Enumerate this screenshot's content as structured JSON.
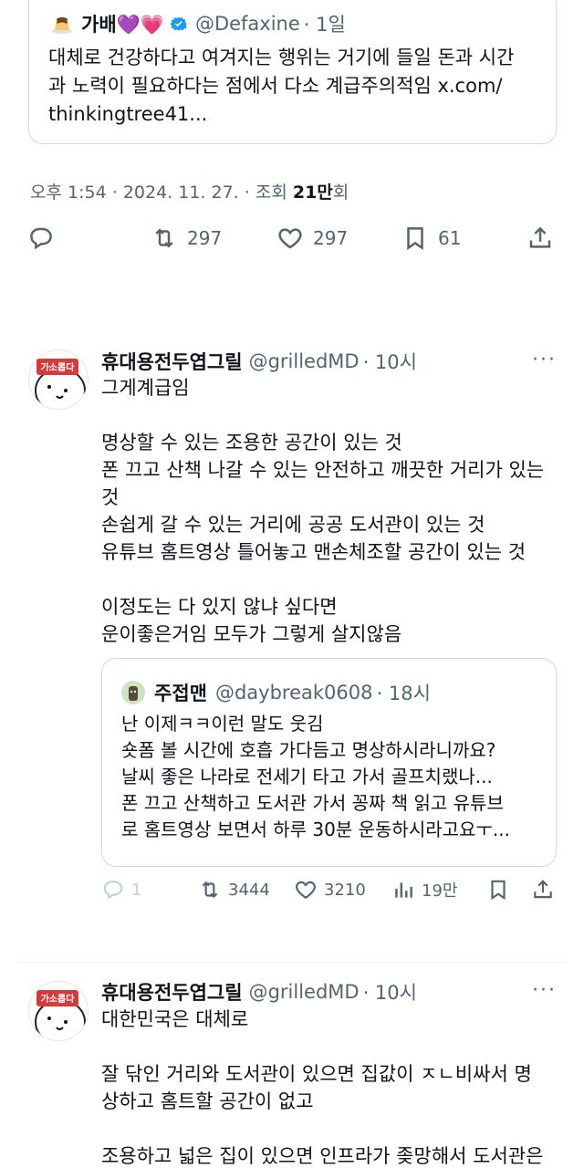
{
  "quoted_top": {
    "display_name": "가배💜💗",
    "handle": "@Defaxine",
    "time": "· 1일",
    "body": "대체로 건강하다고 여겨지는 행위는 거기에 들일 돈과 시간\n과 노력이 필요하다는 점에서 다소 계급주의적임 x.com/\nthinkingtree41..."
  },
  "meta": {
    "time": "오후 1:54",
    "date": "2024. 11. 27.",
    "views_label": "조회",
    "views": "21만",
    "views_suffix": "회"
  },
  "main_actions": {
    "reply_icon": "reply-icon",
    "retweets": "297",
    "likes": "297",
    "bookmarks": "61"
  },
  "reply1": {
    "display_name": "휴대용전두엽그릴",
    "handle": "@grilledMD",
    "time": "· 10시",
    "more": "···",
    "avatar_text": "가소롭다",
    "body": "그게계급임\n\n명상할 수 있는 조용한 공간이 있는 것\n폰 끄고 산책 나갈 수 있는 안전하고 깨끗한 거리가 있는\n것\n손쉽게 갈 수 있는 거리에 공공 도서관이 있는 것\n유튜브 홈트영상 틀어놓고 맨손체조할 공간이 있는 것\n\n이정도는 다 있지 않냐 싶다면\n운이좋은거임 모두가 그렇게 살지않음",
    "quote": {
      "display_name": "주접맨",
      "handle": "@daybreak0608",
      "time": "· 18시",
      "body": "난 이제ㅋㅋ이런 말도 웃김\n숏폼 볼 시간에 호흡 가다듬고 명상하시라니까요?\n날씨 좋은 나라로 전세기 타고 가서 골프치랬나...\n폰 끄고 산책하고 도서관 가서 꽁짜 책 읽고 유튜브\n로 홈트영상 보면서 하루 30분 운동하시라고요ㅜ..."
    },
    "actions": {
      "replies": "1",
      "retweets": "3444",
      "likes": "3210",
      "views": "19만"
    }
  },
  "reply2": {
    "display_name": "휴대용전두엽그릴",
    "handle": "@grilledMD",
    "time": "· 10시",
    "more": "···",
    "avatar_text": "가소롭다",
    "body": "대한민국은 대체로\n\n잘 닦인 거리와 도서관이 있으면 집값이 ㅈㄴ비싸서 명\n상하고 홈트할 공간이 없고\n\n조용하고 넓은 집이 있으면 인프라가 좆망해서 도서관은"
  }
}
